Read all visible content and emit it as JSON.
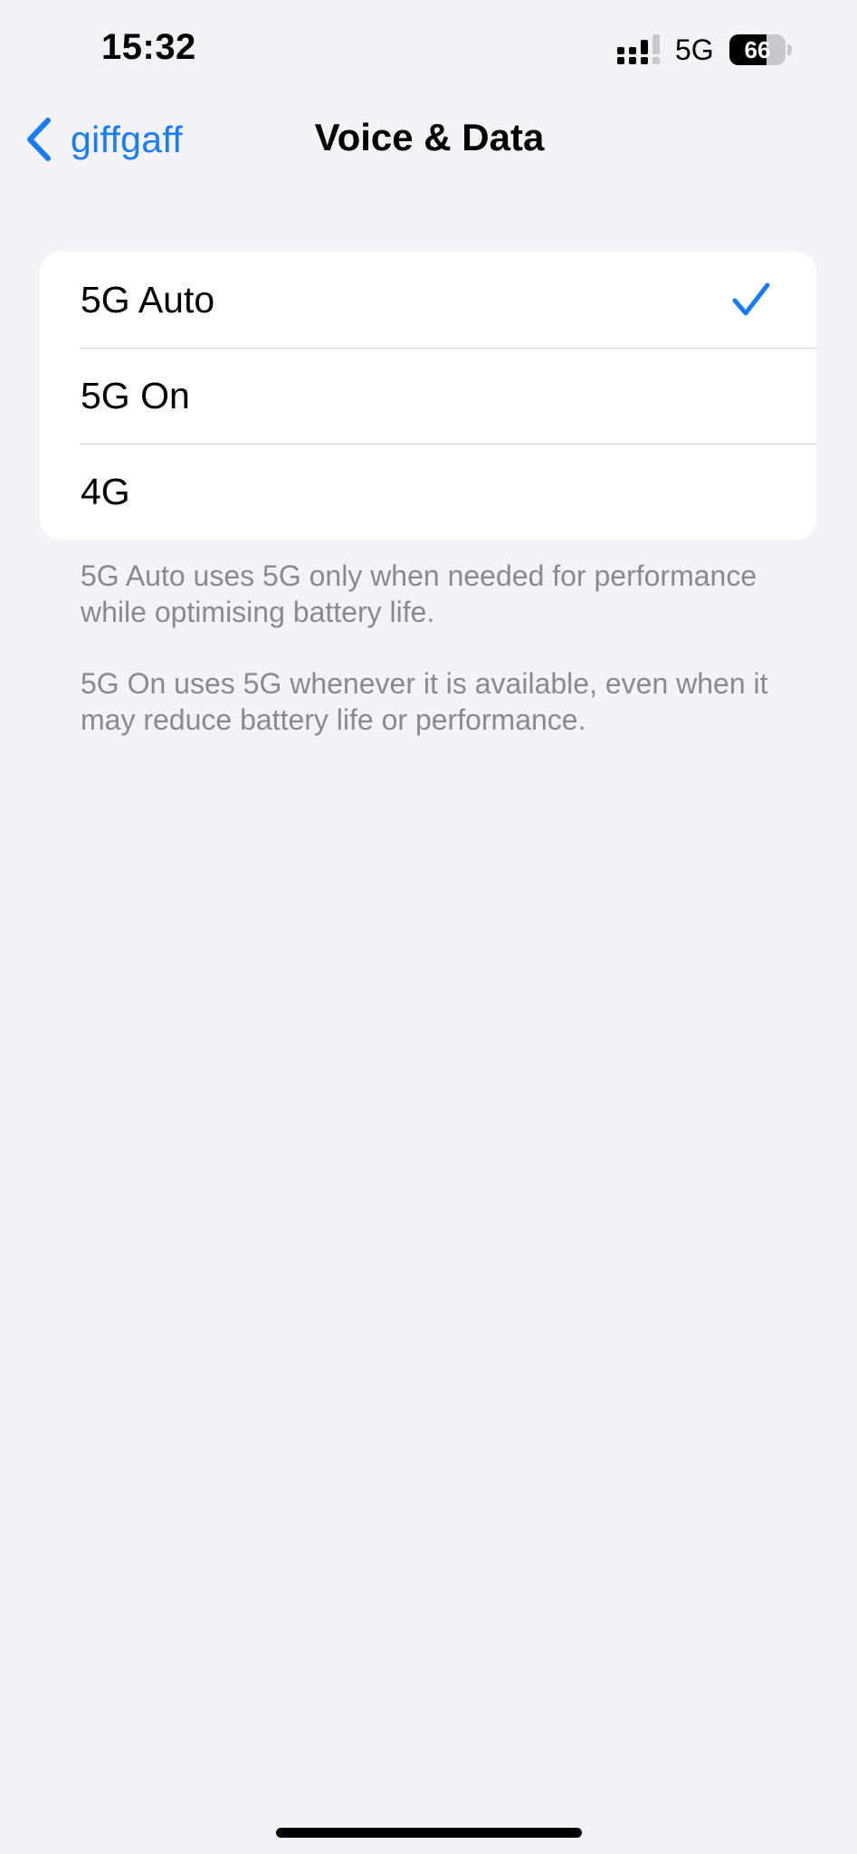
{
  "status_bar": {
    "time": "15:32",
    "network": "5G",
    "battery_percent": "66",
    "battery_level": 0.66,
    "signal_icon": "cellular-signal-icon"
  },
  "nav": {
    "back_label": "giffgaff",
    "back_icon": "chevron-left-icon",
    "title": "Voice & Data"
  },
  "options": [
    {
      "label": "5G Auto",
      "selected": true
    },
    {
      "label": "5G On",
      "selected": false
    },
    {
      "label": "4G",
      "selected": false
    }
  ],
  "notes": {
    "auto": "5G Auto uses 5G only when needed for performance while optimising battery life.",
    "on": "5G On uses 5G whenever it is available, even when it may reduce battery life or performance."
  },
  "colors": {
    "accent": "#1a7cf5",
    "background": "#f2f2f7",
    "group_background": "#ffffff",
    "footnote_text": "#8a8a8e",
    "separator": "#d1d1d6"
  }
}
